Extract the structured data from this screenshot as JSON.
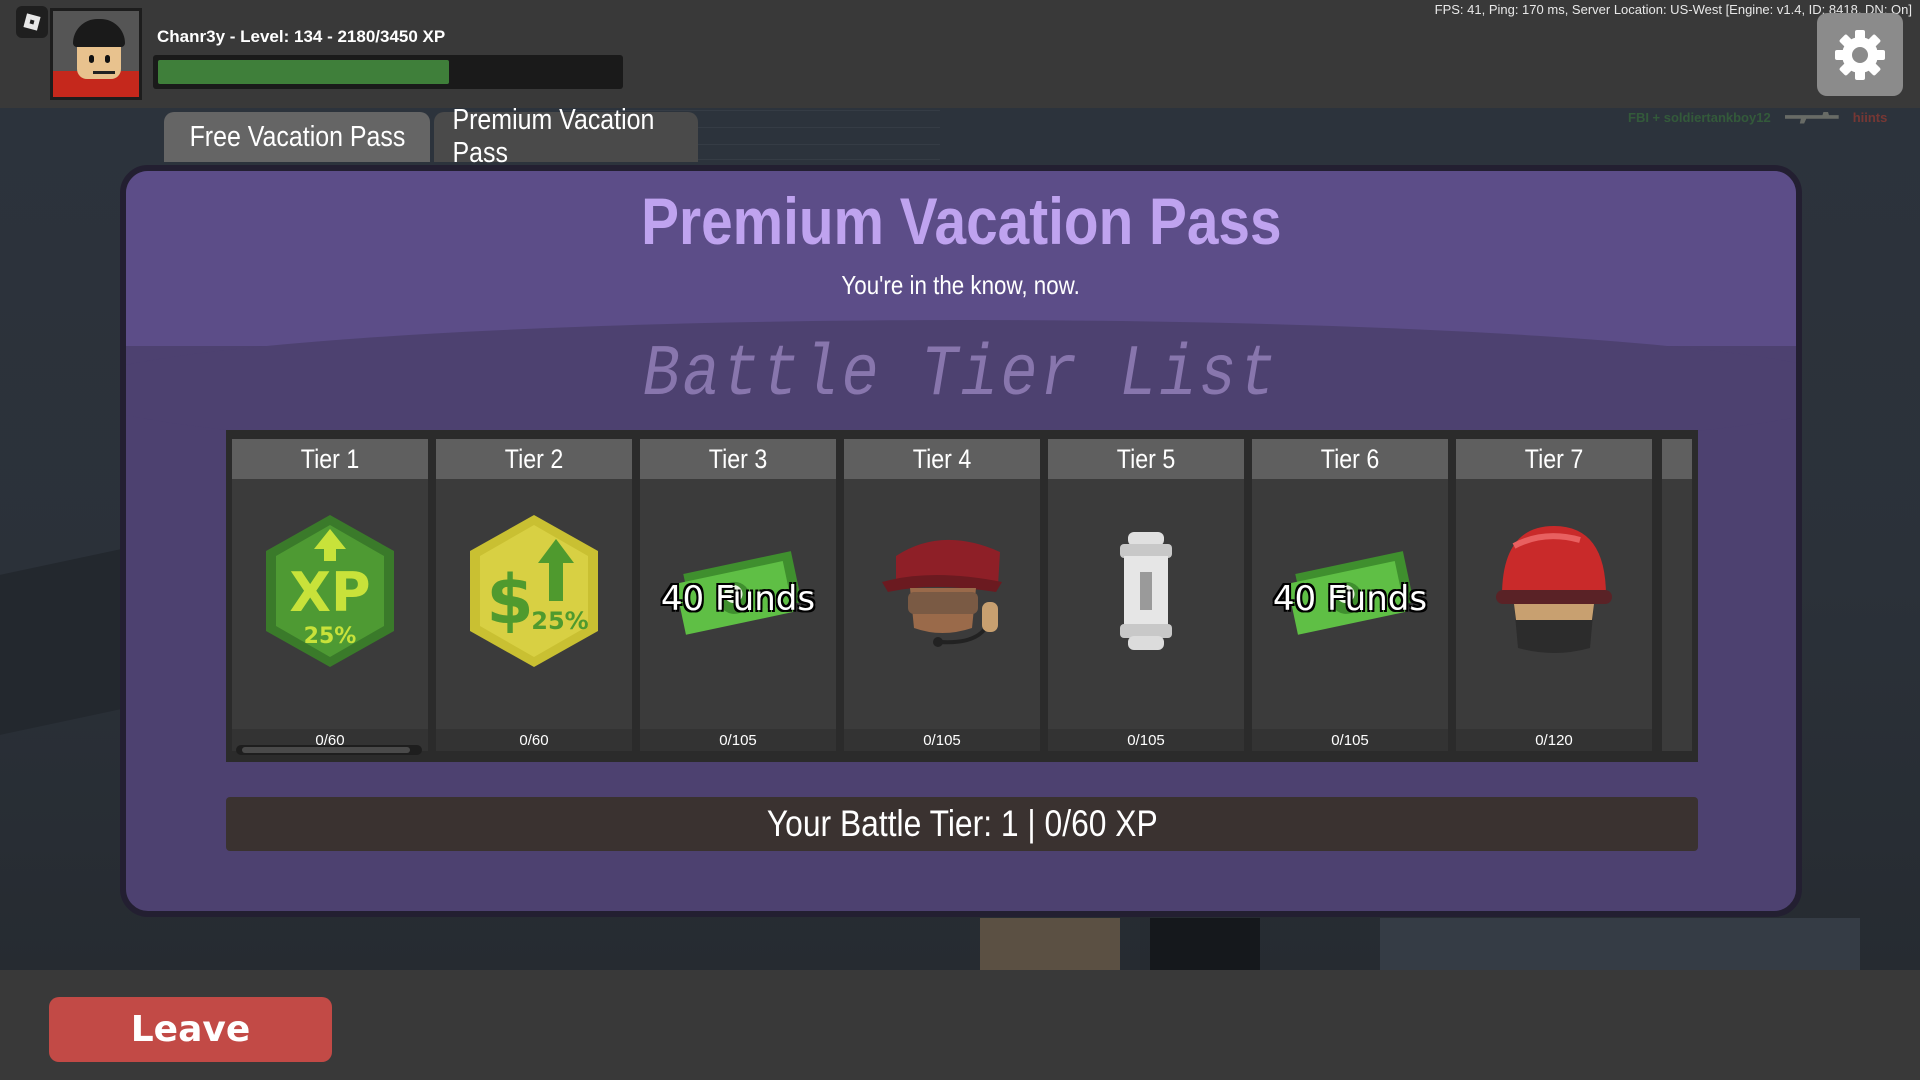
{
  "topbar": {
    "player_info": "Chanr3y - Level: 134 - 2180/3450 XP",
    "xp_progress": 0.632,
    "perf_stats": "FPS: 41, Ping: 170 ms, Server Location: US-West [Engine: v1.4, ID: 8418, DN: On]",
    "settings_icon": "gear-icon",
    "menu_icon": "roblox-menu-icon"
  },
  "killfeed": {
    "killer": "FBI + soldiertankboy12",
    "victim": "hiints",
    "weapon_icon": "rifle-icon"
  },
  "tabs": [
    {
      "label": "Free Vacation Pass"
    },
    {
      "label": "Premium Vacation Pass"
    }
  ],
  "panel": {
    "title": "Premium Vacation Pass",
    "subtitle": "You're in the know, now.",
    "tier_list_label": "Battle Tier List",
    "tiers": [
      {
        "name": "Tier 1",
        "progress": "0/60",
        "reward": "xp-boost-25-icon"
      },
      {
        "name": "Tier 2",
        "progress": "0/60",
        "reward": "cash-boost-25-icon"
      },
      {
        "name": "Tier 3",
        "progress": "0/105",
        "reward": "funds-icon",
        "funds_label": "40 Funds"
      },
      {
        "name": "Tier 4",
        "progress": "0/105",
        "reward": "red-cap-headset-icon"
      },
      {
        "name": "Tier 5",
        "progress": "0/105",
        "reward": "silver-canister-icon"
      },
      {
        "name": "Tier 6",
        "progress": "0/105",
        "reward": "funds-icon",
        "funds_label": "40 Funds"
      },
      {
        "name": "Tier 7",
        "progress": "0/120",
        "reward": "red-helmet-mask-icon"
      }
    ],
    "battle_tier": "Your Battle Tier: 1 | 0/60 XP"
  },
  "leave_label": "Leave",
  "colors": {
    "panel_bg": "#4d4170",
    "panel_header": "#5c4d88",
    "title_color": "#bfa3ef",
    "xp_fill": "#3f7f3a",
    "leave_button": "#c24a46"
  }
}
